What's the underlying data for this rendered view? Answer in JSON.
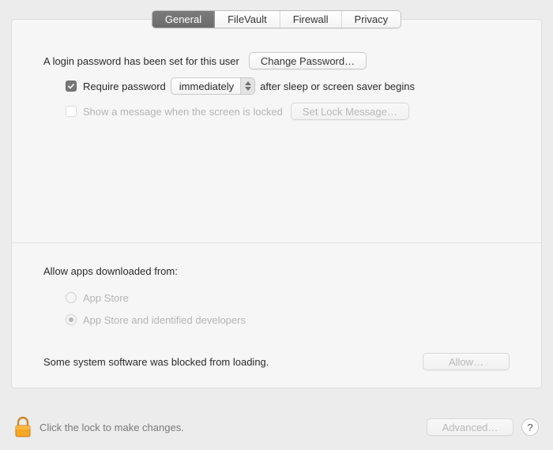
{
  "tabs": {
    "items": [
      {
        "label": "General",
        "selected": true
      },
      {
        "label": "FileVault",
        "selected": false
      },
      {
        "label": "Firewall",
        "selected": false
      },
      {
        "label": "Privacy",
        "selected": false
      }
    ]
  },
  "login": {
    "statement": "A login password has been set for this user",
    "change_button": "Change Password…",
    "require_checkbox_checked": true,
    "require_prefix": "Require password",
    "require_select_value": "immediately",
    "require_suffix": "after sleep or screen saver begins",
    "show_message_checked": false,
    "show_message_label": "Show a message when the screen is locked",
    "set_lock_button": "Set Lock Message…"
  },
  "download": {
    "heading": "Allow apps downloaded from:",
    "options": [
      {
        "label": "App Store",
        "selected": false
      },
      {
        "label": "App Store and identified developers",
        "selected": true
      }
    ]
  },
  "blocked": {
    "message": "Some system software was blocked from loading.",
    "allow_button": "Allow…"
  },
  "footer": {
    "lock_hint": "Click the lock to make changes.",
    "advanced_button": "Advanced…",
    "help_glyph": "?"
  }
}
